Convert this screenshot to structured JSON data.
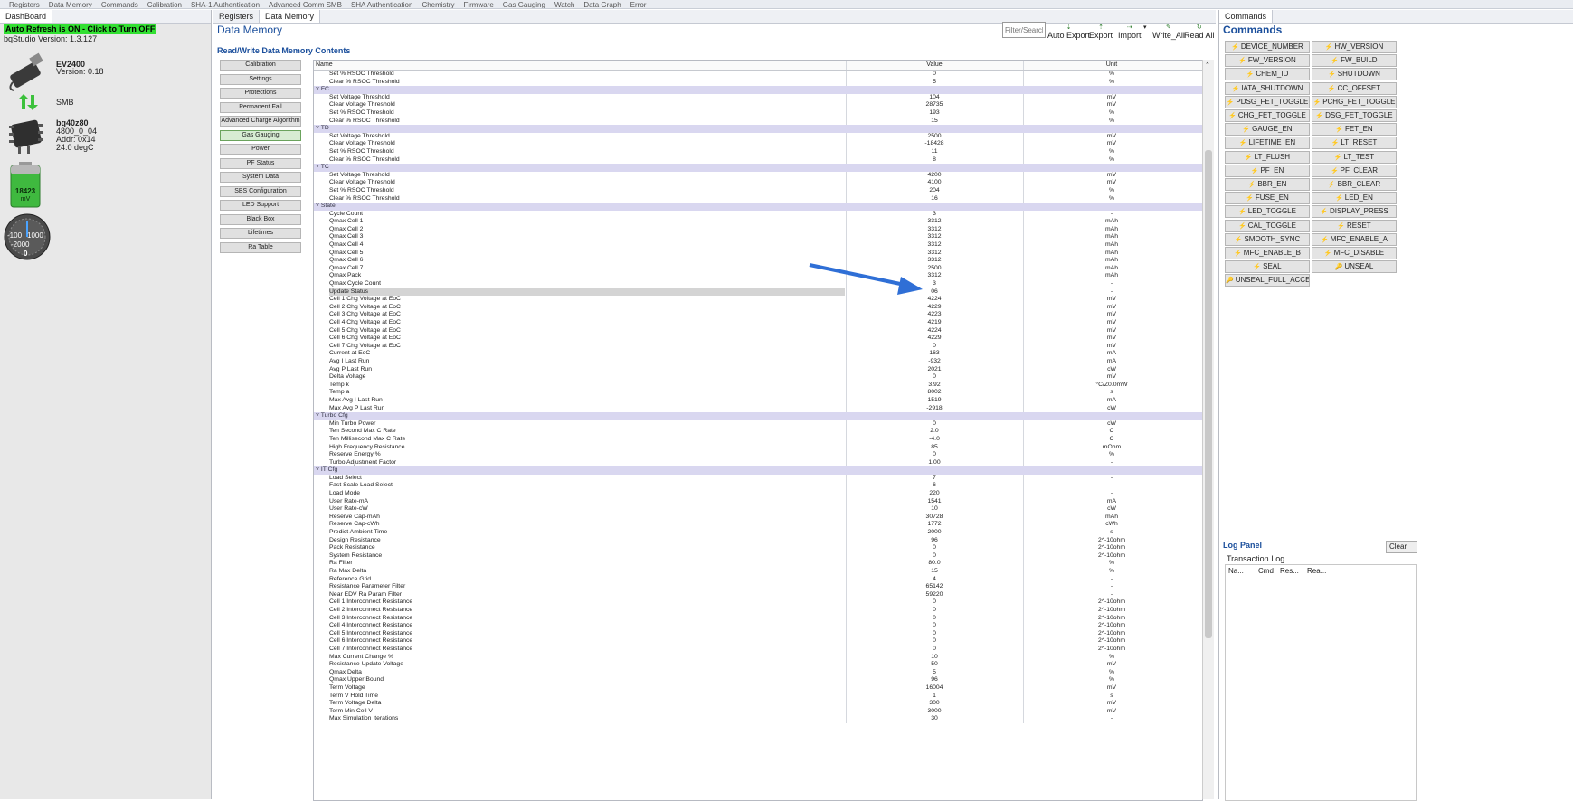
{
  "toolbar": {
    "items": [
      "Registers",
      "Data Memory",
      "Commands",
      "Calibration",
      "SHA-1 Authentication",
      "Advanced Comm SMB",
      "SHA Authentication",
      "Chemistry",
      "Firmware",
      "Gas Gauging",
      "Watch",
      "Data Graph",
      "Error"
    ]
  },
  "dashboard": {
    "tab_label": "DashBoard",
    "auto_refresh": "Auto Refresh is ON - Click to Turn OFF",
    "version_line": "bqStudio Version: 1.3.127",
    "ev_name": "EV2400",
    "ev_version": "Version: 0.18",
    "bus": "SMB",
    "device_name": "bq40z80",
    "device_line1": "4800_0_04",
    "device_line2": "Addr: 0x14",
    "device_line3": "24.0 degC",
    "battery_value": "18423",
    "battery_unit": "mV",
    "gauge_left": "-100",
    "gauge_right": "1000",
    "gauge_mid": "-2000",
    "gauge_value": "0"
  },
  "data_memory": {
    "tabs": [
      "Registers",
      "Data Memory"
    ],
    "title": "Data Memory",
    "subtitle": "Read/Write Data Memory Contents",
    "filter_placeholder": "Filter/Search",
    "buttons": {
      "auto_export": "Auto Export",
      "export": "Export",
      "import": "Import",
      "write_all": "Write_All",
      "read_all": "Read All"
    },
    "categories": [
      "Calibration",
      "Settings",
      "Protections",
      "Permanent Fail",
      "Advanced Charge Algorithm",
      "Gas Gauging",
      "Power",
      "PF Status",
      "System Data",
      "SBS Configuration",
      "LED Support",
      "Black Box",
      "Lifetimes",
      "Ra Table"
    ],
    "selected_category": "Gas Gauging",
    "columns": {
      "name": "Name",
      "value": "Value",
      "unit": "Unit"
    },
    "rows": [
      {
        "n": "Set % RSOC Threshold",
        "v": "0",
        "u": "%"
      },
      {
        "n": "Clear % RSOC Threshold",
        "v": "5",
        "u": "%"
      },
      {
        "g": "˅ FC"
      },
      {
        "n": "Set Voltage Threshold",
        "v": "104",
        "u": "mV"
      },
      {
        "n": "Clear Voltage Threshold",
        "v": "28735",
        "u": "mV"
      },
      {
        "n": "Set % RSOC Threshold",
        "v": "193",
        "u": "%"
      },
      {
        "n": "Clear % RSOC Threshold",
        "v": "15",
        "u": "%"
      },
      {
        "g": "˅ TD"
      },
      {
        "n": "Set Voltage Threshold",
        "v": "2500",
        "u": "mV"
      },
      {
        "n": "Clear Voltage Threshold",
        "v": "-18428",
        "u": "mV"
      },
      {
        "n": "Set % RSOC Threshold",
        "v": "11",
        "u": "%"
      },
      {
        "n": "Clear % RSOC Threshold",
        "v": "8",
        "u": "%"
      },
      {
        "g": "˅ TC"
      },
      {
        "n": "Set Voltage Threshold",
        "v": "4200",
        "u": "mV"
      },
      {
        "n": "Clear Voltage Threshold",
        "v": "4100",
        "u": "mV"
      },
      {
        "n": "Set % RSOC Threshold",
        "v": "204",
        "u": "%"
      },
      {
        "n": "Clear % RSOC Threshold",
        "v": "16",
        "u": "%"
      },
      {
        "g": "˅ State"
      },
      {
        "n": "Cycle Count",
        "v": "3",
        "u": "-"
      },
      {
        "n": "Qmax Cell 1",
        "v": "3312",
        "u": "mAh"
      },
      {
        "n": "Qmax Cell 2",
        "v": "3312",
        "u": "mAh"
      },
      {
        "n": "Qmax Cell 3",
        "v": "3312",
        "u": "mAh"
      },
      {
        "n": "Qmax Cell 4",
        "v": "3312",
        "u": "mAh"
      },
      {
        "n": "Qmax Cell 5",
        "v": "3312",
        "u": "mAh"
      },
      {
        "n": "Qmax Cell 6",
        "v": "3312",
        "u": "mAh"
      },
      {
        "n": "Qmax Cell 7",
        "v": "2500",
        "u": "mAh"
      },
      {
        "n": "Qmax Pack",
        "v": "3312",
        "u": "mAh"
      },
      {
        "n": "Qmax Cycle Count",
        "v": "3",
        "u": "-"
      },
      {
        "n": "Update Status",
        "v": "06",
        "u": "-",
        "hl": true
      },
      {
        "n": "Cell 1 Chg Voltage at EoC",
        "v": "4224",
        "u": "mV"
      },
      {
        "n": "Cell 2 Chg Voltage at EoC",
        "v": "4229",
        "u": "mV"
      },
      {
        "n": "Cell 3 Chg Voltage at EoC",
        "v": "4223",
        "u": "mV"
      },
      {
        "n": "Cell 4 Chg Voltage at EoC",
        "v": "4219",
        "u": "mV"
      },
      {
        "n": "Cell 5 Chg Voltage at EoC",
        "v": "4224",
        "u": "mV"
      },
      {
        "n": "Cell 6 Chg Voltage at EoC",
        "v": "4229",
        "u": "mV"
      },
      {
        "n": "Cell 7 Chg Voltage at EoC",
        "v": "0",
        "u": "mV"
      },
      {
        "n": "Current at EoC",
        "v": "163",
        "u": "mA"
      },
      {
        "n": "Avg I Last Run",
        "v": "-932",
        "u": "mA"
      },
      {
        "n": "Avg P Last Run",
        "v": "2021",
        "u": "cW"
      },
      {
        "n": "Delta Voltage",
        "v": "0",
        "u": "mV"
      },
      {
        "n": "Temp k",
        "v": "3.92",
        "u": "°C/Z0.0mW"
      },
      {
        "n": "Temp a",
        "v": "8002",
        "u": "s"
      },
      {
        "n": "Max Avg I Last Run",
        "v": "1519",
        "u": "mA"
      },
      {
        "n": "Max Avg P Last Run",
        "v": "-2918",
        "u": "cW"
      },
      {
        "g": "˅ Turbo Cfg"
      },
      {
        "n": "Min Turbo Power",
        "v": "0",
        "u": "cW"
      },
      {
        "n": "Ten Second Max C Rate",
        "v": "2.0",
        "u": "C"
      },
      {
        "n": "Ten Millisecond Max C Rate",
        "v": "-4.0",
        "u": "C"
      },
      {
        "n": "High Frequency Resistance",
        "v": "85",
        "u": "mOhm"
      },
      {
        "n": "Reserve Energy %",
        "v": "0",
        "u": "%"
      },
      {
        "n": "Turbo Adjustment Factor",
        "v": "1.00",
        "u": "-"
      },
      {
        "g": "˅ IT Cfg"
      },
      {
        "n": "Load Select",
        "v": "7",
        "u": "-"
      },
      {
        "n": "Fast Scale Load Select",
        "v": "6",
        "u": "-"
      },
      {
        "n": "Load Mode",
        "v": "220",
        "u": "-"
      },
      {
        "n": "User Rate-mA",
        "v": "1541",
        "u": "mA"
      },
      {
        "n": "User Rate-cW",
        "v": "10",
        "u": "cW"
      },
      {
        "n": "Reserve Cap-mAh",
        "v": "30728",
        "u": "mAh"
      },
      {
        "n": "Reserve Cap-cWh",
        "v": "1772",
        "u": "cWh"
      },
      {
        "n": "Predict Ambient Time",
        "v": "2000",
        "u": "s"
      },
      {
        "n": "Design Resistance",
        "v": "96",
        "u": "2^-10ohm"
      },
      {
        "n": "Pack Resistance",
        "v": "0",
        "u": "2^-10ohm"
      },
      {
        "n": "System Resistance",
        "v": "0",
        "u": "2^-10ohm"
      },
      {
        "n": "Ra Filter",
        "v": "80.0",
        "u": "%"
      },
      {
        "n": "Ra Max Delta",
        "v": "15",
        "u": "%"
      },
      {
        "n": "Reference Grid",
        "v": "4",
        "u": "-"
      },
      {
        "n": "Resistance Parameter Filter",
        "v": "65142",
        "u": "-"
      },
      {
        "n": "Near EDV Ra Param Filter",
        "v": "59220",
        "u": "-"
      },
      {
        "n": "Cell 1 Interconnect Resistance",
        "v": "0",
        "u": "2^-10ohm"
      },
      {
        "n": "Cell 2 Interconnect Resistance",
        "v": "0",
        "u": "2^-10ohm"
      },
      {
        "n": "Cell 3 Interconnect Resistance",
        "v": "0",
        "u": "2^-10ohm"
      },
      {
        "n": "Cell 4 Interconnect Resistance",
        "v": "0",
        "u": "2^-10ohm"
      },
      {
        "n": "Cell 5 Interconnect Resistance",
        "v": "0",
        "u": "2^-10ohm"
      },
      {
        "n": "Cell 6 Interconnect Resistance",
        "v": "0",
        "u": "2^-10ohm"
      },
      {
        "n": "Cell 7 Interconnect Resistance",
        "v": "0",
        "u": "2^-10ohm"
      },
      {
        "n": "Max Current Change %",
        "v": "10",
        "u": "%"
      },
      {
        "n": "Resistance Update Voltage",
        "v": "50",
        "u": "mV"
      },
      {
        "n": "Qmax Delta",
        "v": "5",
        "u": "%"
      },
      {
        "n": "Qmax Upper Bound",
        "v": "96",
        "u": "%"
      },
      {
        "n": "Term Voltage",
        "v": "16004",
        "u": "mV"
      },
      {
        "n": "Term V Hold Time",
        "v": "1",
        "u": "s"
      },
      {
        "n": "Term Voltage Delta",
        "v": "300",
        "u": "mV"
      },
      {
        "n": "Term Min Cell V",
        "v": "3000",
        "u": "mV"
      },
      {
        "n": "Max Simulation Iterations",
        "v": "30",
        "u": "-"
      }
    ]
  },
  "commands": {
    "tab_label": "Commands",
    "title": "Commands",
    "buttons": [
      "DEVICE_NUMBER",
      "HW_VERSION",
      "FW_VERSION",
      "FW_BUILD",
      "CHEM_ID",
      "SHUTDOWN",
      "IATA_SHUTDOWN",
      "CC_OFFSET",
      "PDSG_FET_TOGGLE",
      "PCHG_FET_TOGGLE",
      "CHG_FET_TOGGLE",
      "DSG_FET_TOGGLE",
      "GAUGE_EN",
      "FET_EN",
      "LIFETIME_EN",
      "LT_RESET",
      "LT_FLUSH",
      "LT_TEST",
      "PF_EN",
      "PF_CLEAR",
      "BBR_EN",
      "BBR_CLEAR",
      "FUSE_EN",
      "LED_EN",
      "LED_TOGGLE",
      "DISPLAY_PRESS",
      "CAL_TOGGLE",
      "RESET",
      "SMOOTH_SYNC",
      "MFC_ENABLE_A",
      "MFC_ENABLE_B",
      "MFC_DISABLE",
      "SEAL",
      "UNSEAL",
      "UNSEAL_FULL_ACCESS"
    ]
  },
  "log": {
    "title": "Log Panel",
    "clear_label": "Clear Log",
    "transaction_label": "Transaction Log",
    "columns": [
      "Na...",
      "Cmd",
      "Res...",
      "Rea..."
    ]
  },
  "colors": {
    "accent": "#1b4f9c",
    "group_row": "#d9d7f0",
    "auto_refresh_bg": "#32e032",
    "arrow": "#2f6fd6"
  }
}
